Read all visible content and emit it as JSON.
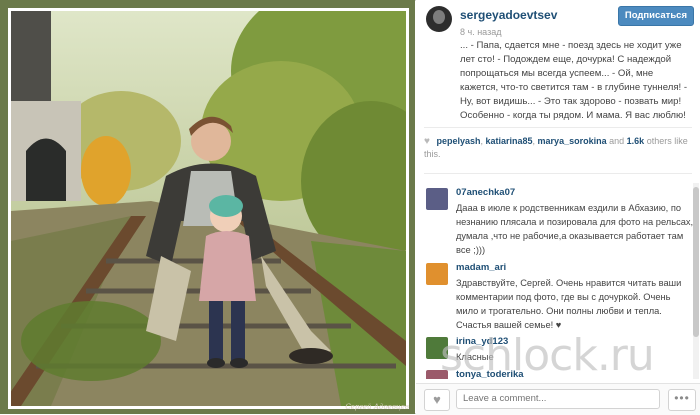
{
  "post": {
    "username": "sergeyadoevtsev",
    "time_ago": "8 ч. назад",
    "follow_label": "Подписаться",
    "caption": "... - Папа, сдается мне - поезд здесь не ходит уже лет сто! - Подождем еще, дочурка! С надеждой попрощаться мы всегда успеем... - Ой, мне кажется, что-то светится там - в глубине туннеля! - Ну, вот видишь... - Это так здорово - позвать мир! Особенно - когда ты рядом. И мама. Я вас люблю!",
    "likes": {
      "users": [
        "pepelyash",
        "katiarina85",
        "marya_sorokina"
      ],
      "and_label": "and",
      "count": "1.6k",
      "suffix": "others like this."
    },
    "photo_credit": "Сергей Адоевцев"
  },
  "comments": [
    {
      "user": "07anechka07",
      "text": "Дааа в июле к родственникам ездили в Абхазию, по незнанию плясала и позировала для фото на рельсах, думала ,что не рабочие,а оказывается работает там все ;)))",
      "avatar_color": "#5b5e86"
    },
    {
      "user": "madam_ari",
      "text": "Здравствуйте, Сергей. Очень нравится читать ваши комментарии под фото, где вы с дочуркой. Очень мило и трогательно. Они полны любви и тепла. Счастья вашей семье! ♥",
      "avatar_color": "#e0902e"
    },
    {
      "user": "irina_yd123",
      "text": "Класные",
      "avatar_color": "#4f7a3a"
    },
    {
      "user": "tonya_toderika",
      "text": "",
      "avatar_color": "#9b5a6a"
    }
  ],
  "footer": {
    "comment_placeholder": "Leave a comment...",
    "more_label": "•••",
    "like_icon": "heart-icon"
  },
  "watermark": "schlock.ru"
}
